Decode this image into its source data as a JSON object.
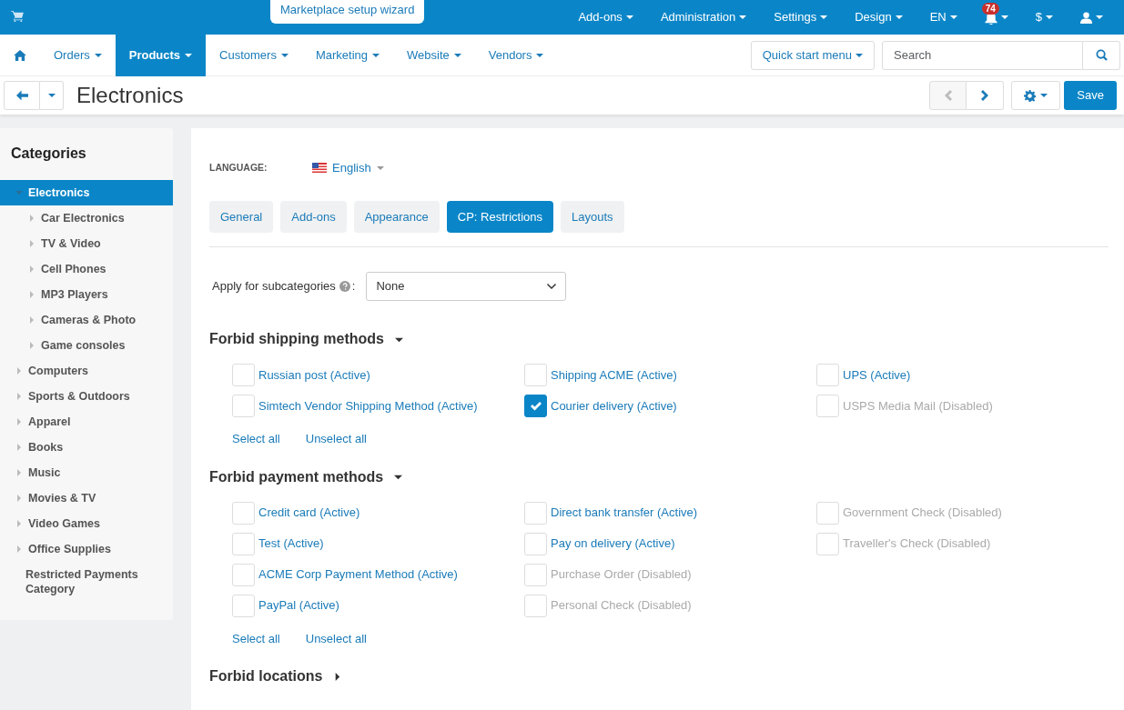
{
  "top_bar": {
    "wizard_button": "Marketplace setup wizard",
    "menus": [
      {
        "label": "Add-ons"
      },
      {
        "label": "Administration"
      },
      {
        "label": "Settings"
      },
      {
        "label": "Design"
      },
      {
        "label": "EN"
      }
    ],
    "notifications_badge": "74",
    "currency": "$"
  },
  "main_nav": {
    "items": [
      {
        "label": "Orders",
        "selected": false
      },
      {
        "label": "Products",
        "selected": true
      },
      {
        "label": "Customers",
        "selected": false
      },
      {
        "label": "Marketing",
        "selected": false
      },
      {
        "label": "Website",
        "selected": false
      },
      {
        "label": "Vendors",
        "selected": false
      }
    ],
    "quick_start": "Quick start menu",
    "search": {
      "placeholder": "Search"
    }
  },
  "toolbar": {
    "title": "Electronics",
    "prev_disabled": true,
    "next_disabled": false,
    "save": "Save"
  },
  "sidebar": {
    "title": "Categories",
    "items": [
      {
        "label": "Electronics",
        "selected": true,
        "has_children": true,
        "expanded": true,
        "children": [
          {
            "label": "Car Electronics",
            "selected": false,
            "has_children": true,
            "expanded": false
          },
          {
            "label": "TV & Video",
            "selected": false,
            "has_children": true,
            "expanded": false
          },
          {
            "label": "Cell Phones",
            "selected": false,
            "has_children": true,
            "expanded": false
          },
          {
            "label": "MP3 Players",
            "selected": false,
            "has_children": true,
            "expanded": false
          },
          {
            "label": "Cameras & Photo",
            "selected": false,
            "has_children": true,
            "expanded": false
          },
          {
            "label": "Game consoles",
            "selected": false,
            "has_children": true,
            "expanded": false
          }
        ]
      },
      {
        "label": "Computers",
        "selected": false,
        "has_children": true,
        "expanded": false
      },
      {
        "label": "Sports & Outdoors",
        "selected": false,
        "has_children": true,
        "expanded": false
      },
      {
        "label": "Apparel",
        "selected": false,
        "has_children": true,
        "expanded": false
      },
      {
        "label": "Books",
        "selected": false,
        "has_children": true,
        "expanded": false
      },
      {
        "label": "Music",
        "selected": false,
        "has_children": true,
        "expanded": false
      },
      {
        "label": "Movies & TV",
        "selected": false,
        "has_children": true,
        "expanded": false
      },
      {
        "label": "Video Games",
        "selected": false,
        "has_children": true,
        "expanded": false
      },
      {
        "label": "Office Supplies",
        "selected": false,
        "has_children": true,
        "expanded": false
      },
      {
        "label": "Restricted Payments Category",
        "selected": false,
        "has_children": false
      }
    ]
  },
  "content": {
    "language_label": "LANGUAGE:",
    "language": "English",
    "tabs": [
      {
        "label": "General",
        "selected": false
      },
      {
        "label": "Add-ons",
        "selected": false
      },
      {
        "label": "Appearance",
        "selected": false
      },
      {
        "label": "CP: Restrictions",
        "selected": true
      },
      {
        "label": "Layouts",
        "selected": false
      }
    ],
    "apply_label": "Apply for subcategories",
    "apply_colon": ":",
    "apply_value": "None",
    "sections": [
      {
        "title": "Forbid shipping methods",
        "expanded": true,
        "columns": [
          [
            {
              "label": "Russian post (Active)",
              "checked": false,
              "disabled": false
            },
            {
              "label": "Simtech Vendor Shipping Method (Active)",
              "checked": false,
              "disabled": false
            }
          ],
          [
            {
              "label": "Shipping ACME (Active)",
              "checked": false,
              "disabled": false
            },
            {
              "label": "Courier delivery (Active)",
              "checked": true,
              "disabled": false
            }
          ],
          [
            {
              "label": "UPS (Active)",
              "checked": false,
              "disabled": false
            },
            {
              "label": "USPS Media Mail (Disabled)",
              "checked": false,
              "disabled": true
            }
          ]
        ],
        "select_all": "Select all",
        "unselect_all": "Unselect all"
      },
      {
        "title": "Forbid payment methods",
        "expanded": true,
        "columns": [
          [
            {
              "label": "Credit card (Active)",
              "checked": false,
              "disabled": false
            },
            {
              "label": "Test (Active)",
              "checked": false,
              "disabled": false
            },
            {
              "label": "ACME Corp Payment Method (Active)",
              "checked": false,
              "disabled": false
            },
            {
              "label": "PayPal (Active)",
              "checked": false,
              "disabled": false
            }
          ],
          [
            {
              "label": "Direct bank transfer (Active)",
              "checked": false,
              "disabled": false
            },
            {
              "label": "Pay on delivery (Active)",
              "checked": false,
              "disabled": false
            },
            {
              "label": "Purchase Order (Disabled)",
              "checked": false,
              "disabled": true
            },
            {
              "label": "Personal Check (Disabled)",
              "checked": false,
              "disabled": true
            }
          ],
          [
            {
              "label": "Government Check (Disabled)",
              "checked": false,
              "disabled": true
            },
            {
              "label": "Traveller's Check (Disabled)",
              "checked": false,
              "disabled": true
            }
          ]
        ],
        "select_all": "Select all",
        "unselect_all": "Unselect all"
      },
      {
        "title": "Forbid locations",
        "expanded": false
      }
    ]
  }
}
